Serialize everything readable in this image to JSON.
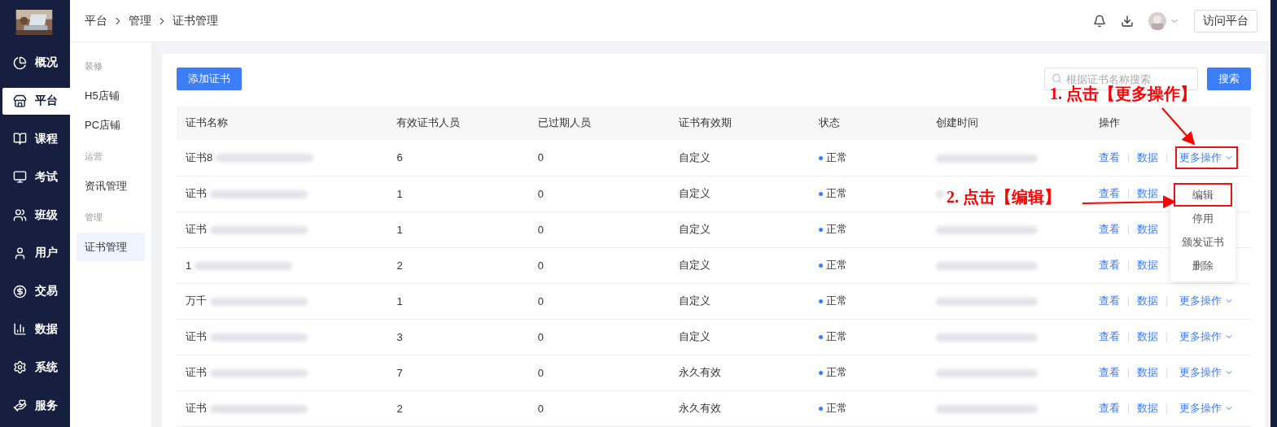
{
  "sidebar": {
    "items": [
      {
        "label": "概况",
        "selected": false
      },
      {
        "label": "平台",
        "selected": true
      },
      {
        "label": "课程",
        "selected": false
      },
      {
        "label": "考试",
        "selected": false
      },
      {
        "label": "班级",
        "selected": false
      },
      {
        "label": "用户",
        "selected": false
      },
      {
        "label": "交易",
        "selected": false
      },
      {
        "label": "数据",
        "selected": false
      },
      {
        "label": "系统",
        "selected": false
      },
      {
        "label": "服务",
        "selected": false
      }
    ]
  },
  "breadcrumb": [
    "平台",
    "管理",
    "证书管理"
  ],
  "header": {
    "visit_button": "访问平台"
  },
  "submenu": [
    {
      "heading": "装修",
      "items": [
        {
          "label": "H5店铺",
          "selected": false
        },
        {
          "label": "PC店铺",
          "selected": false
        }
      ]
    },
    {
      "heading": "运营",
      "items": [
        {
          "label": "资讯管理",
          "selected": false
        }
      ]
    },
    {
      "heading": "管理",
      "items": [
        {
          "label": "证书管理",
          "selected": true
        }
      ]
    }
  ],
  "toolbar": {
    "add_button": "添加证书",
    "search": {
      "placeholder": "根据证书名称搜索"
    },
    "search_button": "搜索"
  },
  "table": {
    "columns": [
      "证书名称",
      "有效证书人员",
      "已过期人员",
      "证书有效期",
      "状态",
      "创建时间",
      "操作"
    ],
    "rows": [
      {
        "name": "证书8",
        "valid": "6",
        "expired": "0",
        "validity": "自定义",
        "status": "正常",
        "actions": [
          "查看",
          "数据"
        ],
        "more": {
          "label": "更多操作",
          "highlighted": true
        }
      },
      {
        "name": "证书",
        "valid": "1",
        "expired": "0",
        "validity": "自定义",
        "status": "正常",
        "actions": [
          "查看",
          "数据"
        ]
      },
      {
        "name": "证书",
        "valid": "1",
        "expired": "0",
        "validity": "自定义",
        "status": "正常",
        "actions": [
          "查看",
          "数据"
        ]
      },
      {
        "name": "1",
        "valid": "2",
        "expired": "0",
        "validity": "自定义",
        "status": "正常",
        "actions": [
          "查看",
          "数据"
        ]
      },
      {
        "name": "万千",
        "valid": "1",
        "expired": "0",
        "validity": "自定义",
        "status": "正常",
        "actions": [
          "查看",
          "数据"
        ],
        "more": {
          "label": "更多操作",
          "highlighted": false
        }
      },
      {
        "name": "证书",
        "valid": "3",
        "expired": "0",
        "validity": "自定义",
        "status": "正常",
        "actions": [
          "查看",
          "数据"
        ],
        "more": {
          "label": "更多操作",
          "highlighted": false
        }
      },
      {
        "name": "证书",
        "valid": "7",
        "expired": "0",
        "validity": "永久有效",
        "status": "正常",
        "actions": [
          "查看",
          "数据"
        ],
        "more": {
          "label": "更多操作",
          "highlighted": false
        }
      },
      {
        "name": "证书",
        "valid": "2",
        "expired": "0",
        "validity": "永久有效",
        "status": "正常",
        "actions": [
          "查看",
          "数据"
        ],
        "more": {
          "label": "更多操作",
          "highlighted": false
        }
      }
    ]
  },
  "dropdown": [
    {
      "label": "编辑",
      "highlighted": true
    },
    {
      "label": "停用",
      "highlighted": false
    },
    {
      "label": "颁发证书",
      "highlighted": false
    },
    {
      "label": "删除",
      "highlighted": false
    }
  ],
  "annotations": [
    "1. 点击【更多操作】",
    "2. 点击【编辑】"
  ]
}
